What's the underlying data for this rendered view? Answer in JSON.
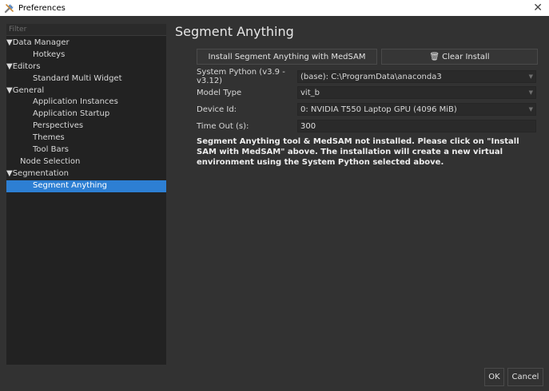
{
  "window": {
    "title": "Preferences",
    "icon": "preferences-tools-icon",
    "close_glyph": "✕"
  },
  "sidebar": {
    "filter_placeholder": "Filter",
    "items": [
      {
        "label": "Data Manager",
        "type": "category",
        "expanded": true
      },
      {
        "label": "Hotkeys",
        "type": "child"
      },
      {
        "label": "Editors",
        "type": "category",
        "expanded": true
      },
      {
        "label": "Standard Multi Widget",
        "type": "child"
      },
      {
        "label": "General",
        "type": "category",
        "expanded": true
      },
      {
        "label": "Application Instances",
        "type": "child"
      },
      {
        "label": "Application Startup",
        "type": "child"
      },
      {
        "label": "Perspectives",
        "type": "child"
      },
      {
        "label": "Themes",
        "type": "child"
      },
      {
        "label": "Tool Bars",
        "type": "child"
      },
      {
        "label": "Node Selection",
        "type": "leaf"
      },
      {
        "label": "Segmentation",
        "type": "category",
        "expanded": true
      },
      {
        "label": "Segment Anything",
        "type": "child",
        "selected": true
      }
    ]
  },
  "main": {
    "title": "Segment Anything",
    "install_button": "Install Segment Anything with MedSAM",
    "clear_button": "Clear Install",
    "fields": {
      "python": {
        "label": "System Python (v3.9 - v3.12)",
        "value": "(base): C:\\ProgramData\\anaconda3"
      },
      "model": {
        "label": "Model Type",
        "value": "vit_b"
      },
      "device": {
        "label": "Device Id:",
        "value": "0: NVIDIA T550 Laptop GPU (4096 MiB)"
      },
      "timeout": {
        "label": "Time Out (s):",
        "value": "300"
      }
    },
    "info_text": "Segment Anything tool & MedSAM not installed. Please click on \"Install SAM with MedSAM\" above. The installation will create a new virtual environment using the System Python selected above."
  },
  "footer": {
    "ok": "OK",
    "cancel": "Cancel"
  },
  "colors": {
    "selection": "#2d7fd3",
    "background": "#323232",
    "panel": "#222222"
  }
}
